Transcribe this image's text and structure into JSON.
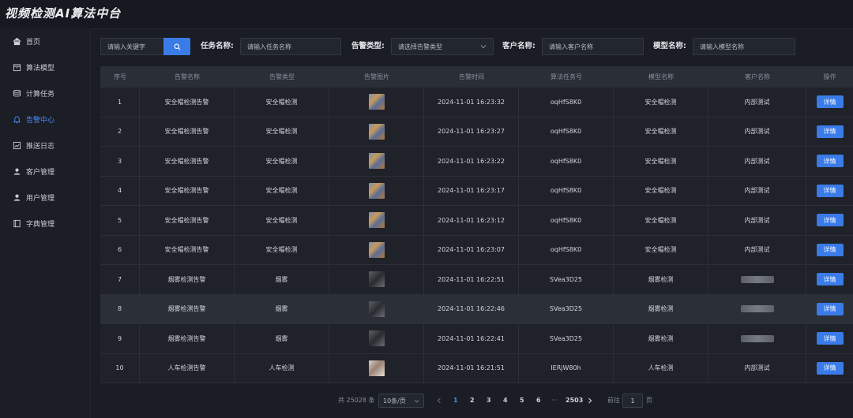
{
  "app": {
    "title": "视频检测AI算法中台"
  },
  "sidebar": {
    "items": [
      {
        "label": "首页",
        "icon": "home-icon"
      },
      {
        "label": "算法模型",
        "icon": "package-icon"
      },
      {
        "label": "计算任务",
        "icon": "database-icon"
      },
      {
        "label": "告警中心",
        "icon": "bell-icon",
        "active": true
      },
      {
        "label": "推送日志",
        "icon": "chart-icon"
      },
      {
        "label": "客户管理",
        "icon": "user-icon"
      },
      {
        "label": "用户管理",
        "icon": "user-icon"
      },
      {
        "label": "字典管理",
        "icon": "book-icon"
      }
    ]
  },
  "filters": {
    "keyword_placeholder": "请输入关键字",
    "task_label": "任务名称:",
    "task_placeholder": "请输入任务名称",
    "alarm_type_label": "告警类型:",
    "alarm_type_placeholder": "请选择告警类型",
    "customer_label": "客户名称:",
    "customer_placeholder": "请输入客户名称",
    "model_label": "模型名称:",
    "model_placeholder": "请输入模型名称"
  },
  "table": {
    "columns": [
      "序号",
      "告警名称",
      "告警类型",
      "告警图片",
      "告警时间",
      "算法任务号",
      "模型名称",
      "客户名称",
      "操作"
    ],
    "detail_label": "详情",
    "rows": [
      {
        "no": "1",
        "name": "安全帽检测告警",
        "type": "安全帽检测",
        "image": "hat",
        "time": "2024-11-01 16:23:32",
        "task": "oqHfS8K0",
        "model": "安全帽检测",
        "customer": "内部测试"
      },
      {
        "no": "2",
        "name": "安全帽检测告警",
        "type": "安全帽检测",
        "image": "hat",
        "time": "2024-11-01 16:23:27",
        "task": "oqHfS8K0",
        "model": "安全帽检测",
        "customer": "内部测试"
      },
      {
        "no": "3",
        "name": "安全帽检测告警",
        "type": "安全帽检测",
        "image": "hat",
        "time": "2024-11-01 16:23:22",
        "task": "oqHfS8K0",
        "model": "安全帽检测",
        "customer": "内部测试"
      },
      {
        "no": "4",
        "name": "安全帽检测告警",
        "type": "安全帽检测",
        "image": "hat",
        "time": "2024-11-01 16:23:17",
        "task": "oqHfS8K0",
        "model": "安全帽检测",
        "customer": "内部测试"
      },
      {
        "no": "5",
        "name": "安全帽检测告警",
        "type": "安全帽检测",
        "image": "hat",
        "time": "2024-11-01 16:23:12",
        "task": "oqHfS8K0",
        "model": "安全帽检测",
        "customer": "内部测试"
      },
      {
        "no": "6",
        "name": "安全帽检测告警",
        "type": "安全帽检测",
        "image": "hat",
        "time": "2024-11-01 16:23:07",
        "task": "oqHfS8K0",
        "model": "安全帽检测",
        "customer": "内部测试"
      },
      {
        "no": "7",
        "name": "烟雾检测告警",
        "type": "烟雾",
        "image": "smoke",
        "time": "2024-11-01 16:22:51",
        "task": "SVea3D25",
        "model": "烟雾检测",
        "customer": ""
      },
      {
        "no": "8",
        "name": "烟雾检测告警",
        "type": "烟雾",
        "image": "smoke",
        "time": "2024-11-01 16:22:46",
        "task": "SVea3D25",
        "model": "烟雾检测",
        "customer": ""
      },
      {
        "no": "9",
        "name": "烟雾检测告警",
        "type": "烟雾",
        "image": "smoke",
        "time": "2024-11-01 16:22:41",
        "task": "SVea3D25",
        "model": "烟雾检测",
        "customer": ""
      },
      {
        "no": "10",
        "name": "人车检测告警",
        "type": "人车检测",
        "image": "person",
        "time": "2024-11-01 16:21:51",
        "task": "IERjW80h",
        "model": "人车检测",
        "customer": "内部测试"
      }
    ]
  },
  "pagination": {
    "total_text": "共 25028 条",
    "page_size": "10条/页",
    "pages": [
      "1",
      "2",
      "3",
      "4",
      "5",
      "6"
    ],
    "ellipsis": "···",
    "last_page": "2503",
    "goto_label": "前往",
    "goto_value": "1",
    "goto_suffix": "页"
  },
  "colors": {
    "accent": "#3a7be8",
    "active_text": "#4b8ef7",
    "background": "#1a1d24"
  }
}
